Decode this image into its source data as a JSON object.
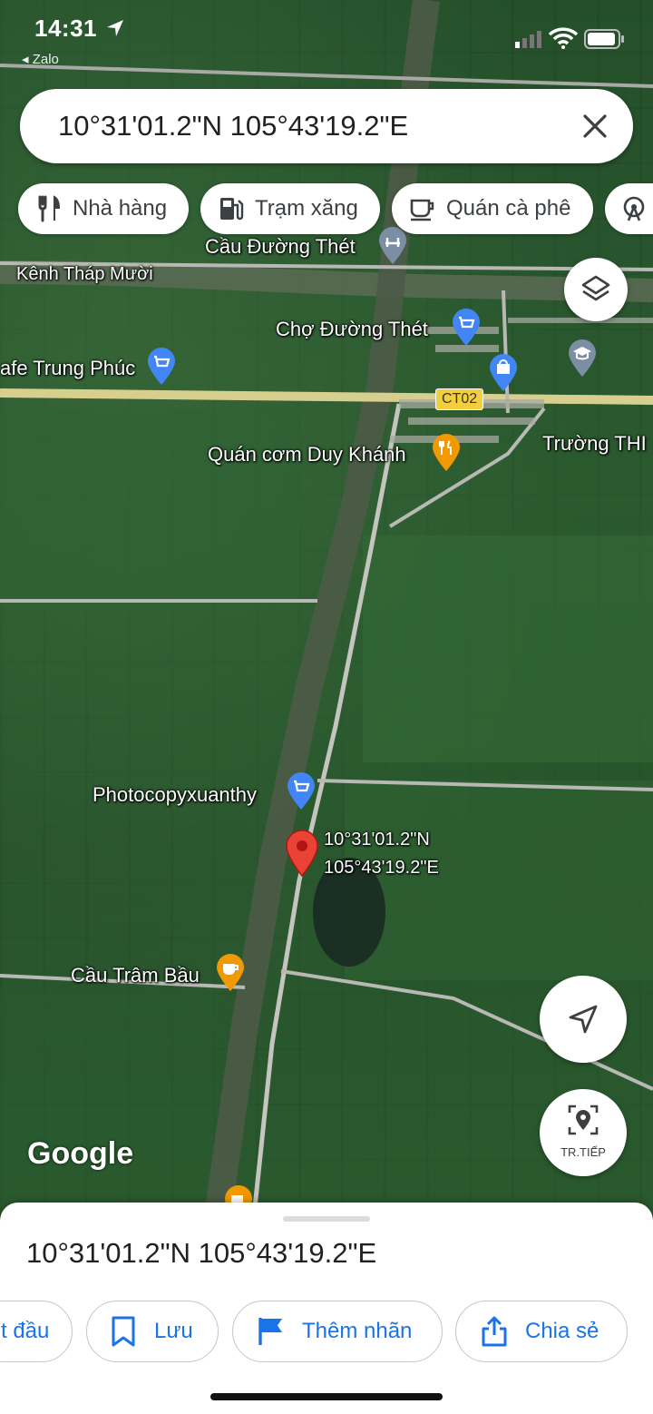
{
  "status_bar": {
    "time": "14:31",
    "back_app": "◂ Zalo"
  },
  "search": {
    "query": "10°31'01.2\"N 105°43'19.2\"E"
  },
  "chips": [
    {
      "label": "Nhà hàng",
      "icon": "restaurant-icon"
    },
    {
      "label": "Trạm xăng",
      "icon": "gas-station-icon"
    },
    {
      "label": "Quán cà phê",
      "icon": "coffee-icon"
    }
  ],
  "map": {
    "places": {
      "bridge_duong_thet": "Cầu Đường Thét",
      "canal_thap_muoi": "Kênh Tháp Mười",
      "market_duong_thet": "Chợ Đường Thét",
      "cafe_trung_phuc": "afe Trung Phúc",
      "road_badge": "CT02",
      "rice_duy_khanh": "Quán cơm Duy Khánh",
      "school": "Trường THI",
      "photocopy": "Photocopyxuanthy",
      "dropped_pin_lat": "10°31'01.2\"N",
      "dropped_pin_lng": "105°43'19.2\"E",
      "cau_tram_bau": "Cầu Trâm Bầu"
    },
    "pin_color": "#ea4335",
    "shop_pin_color": "#4285f4",
    "food_pin_color": "#f29900",
    "logo": "Google",
    "next_label": "TR.TIẾP"
  },
  "sheet": {
    "title": "10°31'01.2\"N 105°43'19.2\"E",
    "actions": [
      {
        "label": "t đầu",
        "icon": ""
      },
      {
        "label": "Lưu",
        "icon": "bookmark-icon"
      },
      {
        "label": "Thêm nhãn",
        "icon": "flag-icon"
      },
      {
        "label": "Chia sẻ",
        "icon": "share-icon"
      }
    ]
  },
  "colors": {
    "accent": "#1a73e8",
    "text": "#202124"
  }
}
